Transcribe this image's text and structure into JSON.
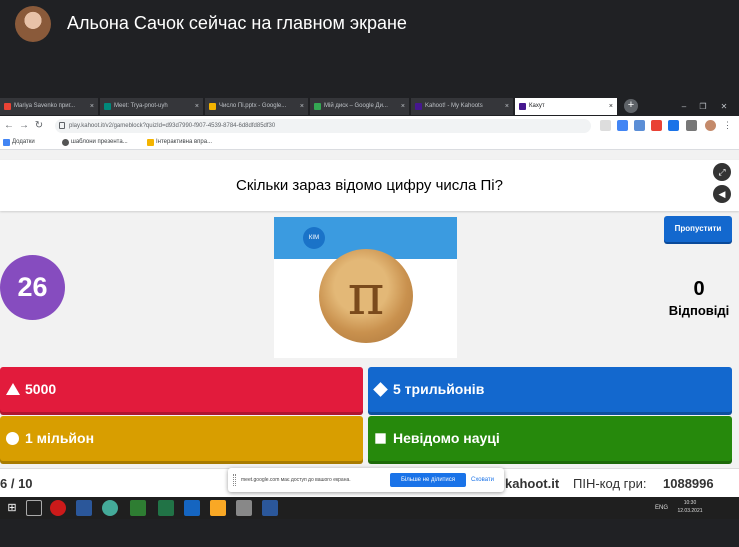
{
  "meet": {
    "presenter_title": "Альона Сачок сейчас на главном экране"
  },
  "browser": {
    "tabs": [
      {
        "label": "Mariya Savenko приг..."
      },
      {
        "label": "Meet: Trya-pnot-uyh"
      },
      {
        "label": "Число Пі.pptx - Google..."
      },
      {
        "label": "Мій диск – Google Ди..."
      },
      {
        "label": "Kahoot! - My Kahoots"
      },
      {
        "label": "Кахут"
      }
    ],
    "new_tab": "+",
    "url": "play.kahoot.it/v2/gameblock?quizId=d93d7990-f907-4539-8784-6d8dfd85df30",
    "bookmarks": [
      {
        "label": "Додатки"
      },
      {
        "label": "шаблони презента..."
      },
      {
        "label": "Інтерактивна впра..."
      }
    ]
  },
  "kahoot": {
    "question": "Скільки зараз відомо цифру числа Пі?",
    "timer": "26",
    "image_logo": "КІМ",
    "image_symbol": "π",
    "skip_label": "Пропустити",
    "answers_count": "0",
    "answers_label": "Відповіді",
    "answers": [
      {
        "text": "5000",
        "shape": "triangle",
        "color": "#e21b3c"
      },
      {
        "text": "5 трильйонів",
        "shape": "diamond",
        "color": "#1368ce"
      },
      {
        "text": "1 мільйон",
        "shape": "circle",
        "color": "#d89e00"
      },
      {
        "text": "Невідомо науці",
        "shape": "square",
        "color": "#26890c"
      }
    ],
    "progress": "6 / 10",
    "site": "kahoot.it",
    "pin_label": "ПІН-код гри:",
    "pin_value": "1088996"
  },
  "share_notice": {
    "text": "meet.google.com має доступ до вашого екрана.",
    "stop_label": "Більше не ділитися",
    "hide_label": "Сховати"
  },
  "taskbar": {
    "lang": "ENG",
    "time": "10:30",
    "date": "12.03.2021"
  },
  "icons": {
    "fullscreen": "fullscreen-icon",
    "sound": "sound-icon"
  }
}
